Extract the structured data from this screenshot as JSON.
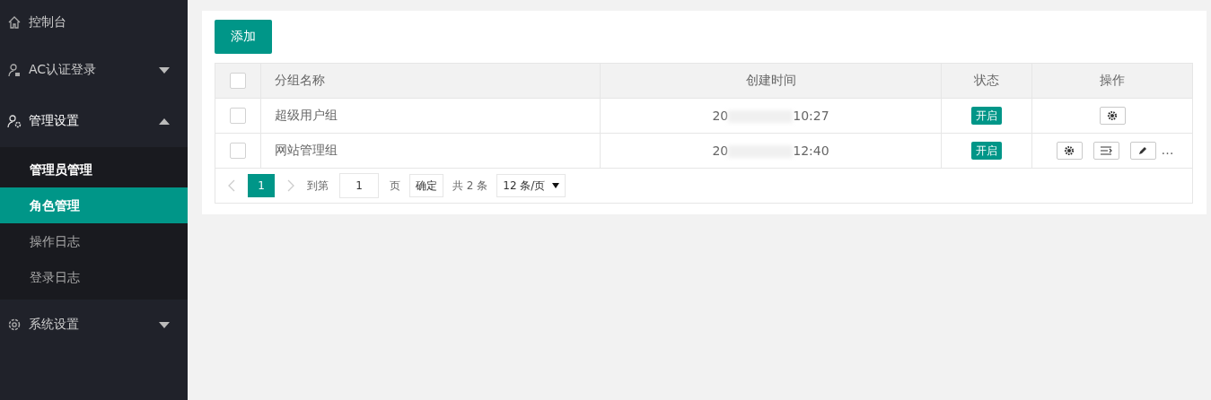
{
  "sidebar": {
    "items": [
      {
        "label": "控制台"
      },
      {
        "label": "AC认证登录",
        "expanded": false
      },
      {
        "label": "管理设置",
        "expanded": true,
        "children": [
          {
            "label": "管理员管理",
            "selected": false,
            "bold": true
          },
          {
            "label": "角色管理",
            "selected": true,
            "bold": true
          },
          {
            "label": "操作日志",
            "selected": false,
            "bold": false
          },
          {
            "label": "登录日志",
            "selected": false,
            "bold": false
          }
        ]
      },
      {
        "label": "系统设置",
        "expanded": false
      }
    ]
  },
  "add_button": "添加",
  "table": {
    "columns": [
      "分组名称",
      "创建时间",
      "状态",
      "操作"
    ],
    "header_checked": false,
    "rows": [
      {
        "checked": false,
        "name": "超级用户组",
        "time_start": "20",
        "time_end": "10:27",
        "status": "开启",
        "actions": [
          {
            "kind": "settings"
          }
        ]
      },
      {
        "checked": false,
        "name": "网站管理组",
        "time_start": "20",
        "time_end": "12:40",
        "status": "开启",
        "actions": [
          {
            "kind": "settings"
          },
          {
            "kind": "indent"
          },
          {
            "kind": "edit"
          }
        ],
        "more": "…"
      }
    ]
  },
  "pager": {
    "pages": [
      {
        "label": "1",
        "selected": true
      }
    ],
    "goto_label": "到第",
    "goto_value": "1",
    "page_suffix": "页",
    "confirm": "确定",
    "total": "共 2 条",
    "page_size": "12 条/页"
  }
}
